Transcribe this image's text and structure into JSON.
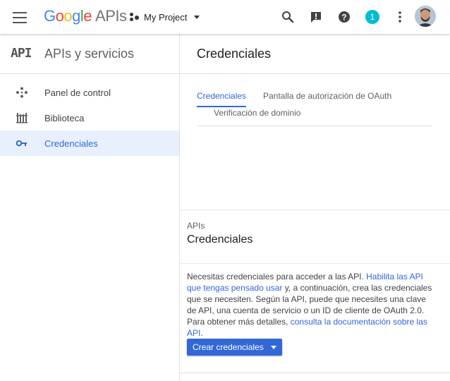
{
  "header": {
    "brand": {
      "g1": "G",
      "g2": "o",
      "g3": "o",
      "g4": "g",
      "g5": "l",
      "g6": "e",
      "apis": "APIs"
    },
    "project_name": "My Project",
    "notification_count": "1",
    "icons": [
      "menu-icon",
      "search-icon",
      "feedback-icon",
      "help-icon",
      "more-vert-icon",
      "avatar"
    ]
  },
  "sidebar": {
    "logo": "API",
    "title": "APIs y servicios",
    "items": [
      {
        "label": "Panel de control",
        "icon": "dashboard-icon"
      },
      {
        "label": "Biblioteca",
        "icon": "library-icon"
      },
      {
        "label": "Credenciales",
        "icon": "key-icon",
        "active": true
      }
    ]
  },
  "main": {
    "title": "Credenciales",
    "tabs": [
      {
        "label": "Credenciales",
        "active": true
      },
      {
        "label": "Pantalla de autorización de OAuth"
      },
      {
        "label": "Verificación de dominio"
      }
    ],
    "section": {
      "label": "APIs",
      "title": "Credenciales",
      "body_part1": "Necesitas credenciales para acceder a las API. ",
      "link1": "Habilita las API que tengas pensado usar",
      "body_part2": " y, a continuación, crea las credenciales que se necesiten. Según la API, puede que necesites una clave de API, una cuenta de servicio o un ID de cliente de OAuth 2.0. Para obtener más detalles, ",
      "link2": "consulta la documentación sobre las API",
      "body_part3": ".",
      "button_label": "Crear credenciales"
    }
  },
  "colors": {
    "accent": "#3367d6",
    "active_bg": "#e8f0fe",
    "badge": "#00bcd4"
  }
}
